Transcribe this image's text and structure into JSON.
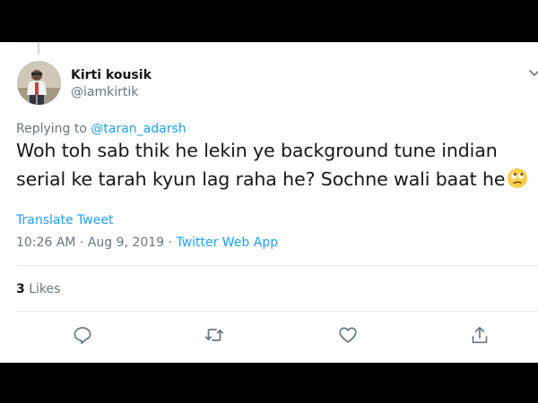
{
  "tweet": {
    "author_name": "Kirti kousik",
    "author_handle": "@iamkirtik",
    "replying_prefix": "Replying to ",
    "replying_to": "@taran_adarsh",
    "text_line_1": "Woh toh sab thik he lekin ye background tune indian",
    "text_line_2": "serial ke tarah kyun lag raha he? Sochne wali baat he",
    "emoji": "face-with-rolling-eyes",
    "translate_label": "Translate Tweet",
    "time": "10:26 AM",
    "separator": " · ",
    "date": "Aug 9, 2019",
    "source_separator": " · ",
    "source": "Twitter Web App",
    "likes_count": "3",
    "likes_label": " Likes"
  },
  "icons": {
    "more": "chevron-down-icon",
    "reply": "reply-icon",
    "retweet": "retweet-icon",
    "like": "heart-icon",
    "share": "share-icon"
  },
  "colors": {
    "text": "#14171a",
    "secondary": "#657786",
    "link": "#1da1f2",
    "divider": "#e6ecf0",
    "letterbox": "#000000"
  }
}
